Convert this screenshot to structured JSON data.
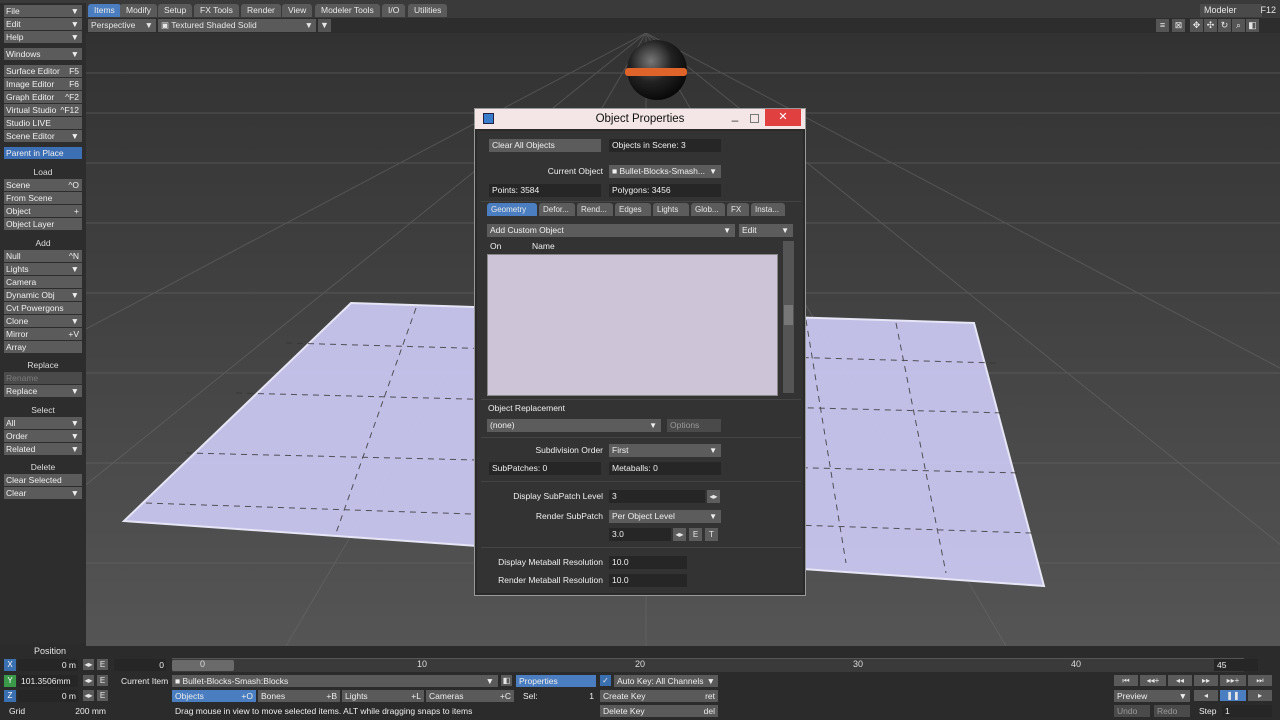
{
  "topbar": {
    "tabs": [
      "Items",
      "Modify",
      "Setup",
      "FX Tools",
      "Render",
      "View",
      "Modeler Tools",
      "I/O",
      "Utilities"
    ],
    "modeler": "Modeler",
    "f12": "F12"
  },
  "viewbar": {
    "view_mode": "Perspective",
    "shading": "Textured Shaded Solid"
  },
  "left": {
    "file": "File",
    "edit": "Edit",
    "help": "Help",
    "windows": "Windows",
    "surface_editor": "Surface Editor",
    "surface_key": "F5",
    "image_editor": "Image Editor",
    "image_key": "F6",
    "graph_editor": "Graph Editor",
    "graph_key": "^F2",
    "virtual_studio": "Virtual Studio",
    "virtual_key": "^F12",
    "studio_live": "Studio LIVE",
    "scene_editor": "Scene Editor",
    "parent_in_place": "Parent in Place",
    "load_head": "Load",
    "scene": "Scene",
    "scene_key": "^O",
    "from_scene": "From Scene",
    "object": "Object",
    "object_key": "+",
    "object_layer": "Object Layer",
    "add_head": "Add",
    "null": "Null",
    "null_key": "^N",
    "lights": "Lights",
    "camera": "Camera",
    "dynamic_obj": "Dynamic Obj",
    "cvt_powergons": "Cvt Powergons",
    "clone": "Clone",
    "mirror": "Mirror",
    "mirror_key": "+V",
    "array": "Array",
    "replace_head": "Replace",
    "rename": "Rename",
    "replace": "Replace",
    "select_head": "Select",
    "all": "All",
    "order": "Order",
    "related": "Related",
    "delete_head": "Delete",
    "clear_selected": "Clear Selected",
    "clear": "Clear"
  },
  "dialog": {
    "title": "Object Properties",
    "close": "✕",
    "minimize": "–",
    "clear_all": "Clear All Objects",
    "objects_in_scene": "Objects in Scene: 3",
    "current_object_label": "Current Object",
    "current_object": "Bullet-Blocks-Smash...",
    "points": "Points: 3584",
    "polygons": "Polygons: 3456",
    "tabs": [
      "Geometry",
      "Defor...",
      "Rend...",
      "Edges",
      "Lights",
      "Glob...",
      "FX",
      "Insta..."
    ],
    "add_custom": "Add Custom Object",
    "edit": "Edit",
    "col_on": "On",
    "col_name": "Name",
    "object_replacement": "Object Replacement",
    "replacement_value": "(none)",
    "options": "Options",
    "subdivision_order_label": "Subdivision Order",
    "subdivision_order": "First",
    "subpatches": "SubPatches: 0",
    "metaballs": "Metaballs: 0",
    "display_subpatch_label": "Display SubPatch Level",
    "display_subpatch": "3",
    "render_subpatch_label": "Render SubPatch",
    "render_subpatch": "Per Object Level",
    "render_subpatch_value": "3.0",
    "e": "E",
    "t": "T",
    "display_metaball_label": "Display Metaball Resolution",
    "display_metaball": "10.0",
    "render_metaball_label": "Render Metaball Resolution",
    "render_metaball": "10.0"
  },
  "bottom": {
    "position": "Position",
    "x_val": "0 m",
    "y_val": "101.3506mm",
    "z_val": "0 m",
    "grid_label": "Grid",
    "grid_val": "200 mm",
    "frame": "0",
    "current_item_label": "Current Item",
    "current_item": "Bullet-Blocks-Smash:Blocks",
    "ticks": [
      "0",
      "10",
      "20",
      "30",
      "40"
    ],
    "end_frame": "45",
    "objects": "Objects",
    "objects_key": "+O",
    "bones": "Bones",
    "bones_key": "+B",
    "lights": "Lights",
    "lights_key": "+L",
    "cameras": "Cameras",
    "cameras_key": "+C",
    "status": "Drag mouse in view to move selected items. ALT while dragging snaps to items",
    "properties": "Properties",
    "sel_label": "Sel:",
    "sel_val": "1",
    "auto_key": "Auto Key: All Channels",
    "create_key": "Create Key",
    "create_key_shortcut": "ret",
    "delete_key": "Delete Key",
    "delete_key_shortcut": "del",
    "preview": "Preview",
    "undo": "Undo",
    "redo": "Redo",
    "step_label": "Step",
    "step_val": "1",
    "e": "E"
  },
  "colors": {
    "accent": "#4a7ec0",
    "close": "#e04040",
    "list_bg": "#cdc4d8",
    "plane": "#c9c6f0"
  }
}
